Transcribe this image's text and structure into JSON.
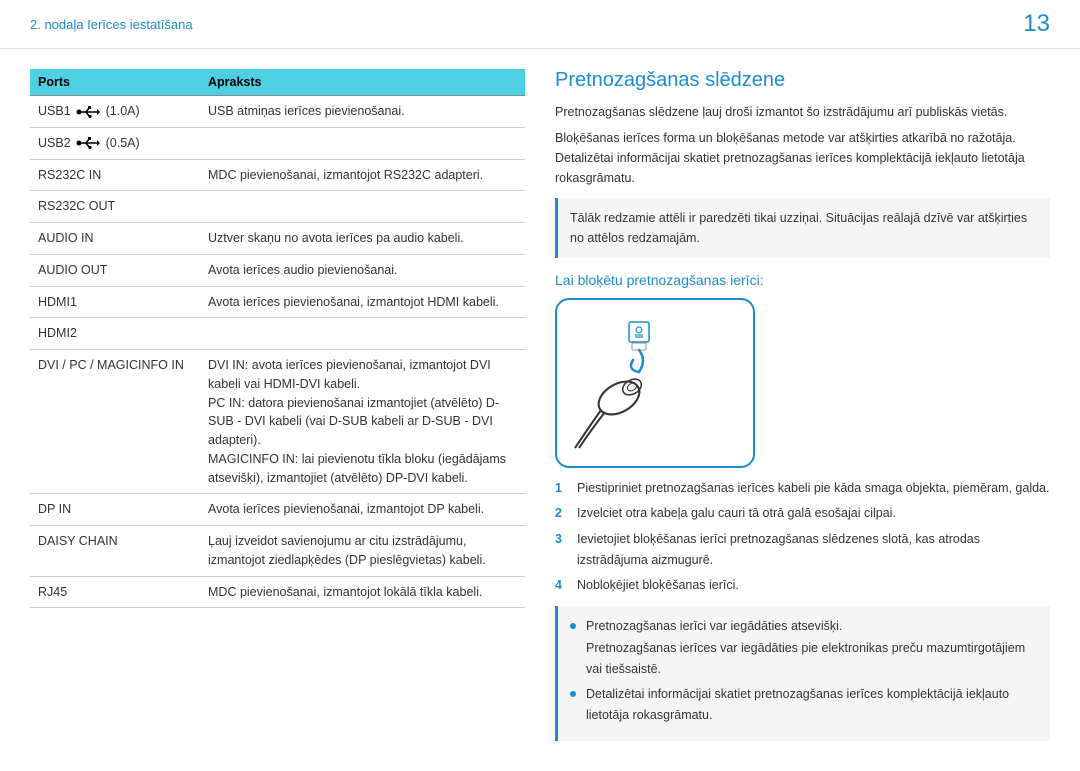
{
  "header": {
    "chapter": "2. nodaļa Ierīces iestatīšana",
    "page": "13"
  },
  "table": {
    "head": {
      "col1": "Ports",
      "col2": "Apraksts"
    },
    "rows": [
      {
        "port": "USB1",
        "icon": "usb",
        "extra": "(1.0A)",
        "desc": "USB atmiņas ierīces pievienošanai."
      },
      {
        "port": "USB2",
        "icon": "usb",
        "extra": "(0.5A)",
        "desc": ""
      },
      {
        "port": "RS232C IN",
        "desc": "MDC pievienošanai, izmantojot RS232C adapteri."
      },
      {
        "port": "RS232C OUT",
        "desc": ""
      },
      {
        "port": "AUDIO IN",
        "desc": "Uztver skaņu no avota ierīces pa audio kabeli."
      },
      {
        "port": "AUDIO OUT",
        "desc": "Avota ierīces audio pievienošanai."
      },
      {
        "port": "HDMI1",
        "desc": "Avota ierīces pievienošanai, izmantojot HDMI kabeli."
      },
      {
        "port": "HDMI2",
        "desc": ""
      },
      {
        "port": "DVI / PC / MAGICINFO IN",
        "desc": "DVI IN: avota ierīces pievienošanai, izmantojot DVI kabeli vai HDMI-DVI kabeli.\nPC IN: datora pievienošanai izmantojiet (atvēlēto) D-SUB - DVI kabeli (vai D-SUB kabeli ar D-SUB - DVI adapteri).\nMAGICINFO IN: lai pievienotu tīkla bloku (iegādājams atsevišķi), izmantojiet (atvēlēto) DP-DVI kabeli."
      },
      {
        "port": "DP IN",
        "desc": "Avota ierīces pievienošanai, izmantojot DP kabeli."
      },
      {
        "port": "DAISY CHAIN",
        "desc": "Ļauj izveidot savienojumu ar citu izstrādājumu, izmantojot ziedlapķēdes (DP pieslēgvietas) kabeli."
      },
      {
        "port": "RJ45",
        "desc": "MDC pievienošanai, izmantojot lokālā tīkla kabeli."
      }
    ]
  },
  "right": {
    "title": "Pretnozagšanas slēdzene",
    "p1": "Pretnozagšanas slēdzene ļauj droši izmantot šo izstrādājumu arī publiskās vietās.",
    "p2": "Bloķēšanas ierīces forma un bloķēšanas metode var atšķirties atkarībā no ražotāja. Detalizētai informācijai skatiet pretnozagšanas ierīces komplektācijā iekļauto lietotāja rokasgrāmatu.",
    "info1": "Tālāk redzamie attēli ir paredzēti tikai uzziņai. Situācijas reālajā dzīvē var atšķirties no attēlos redzamajām.",
    "subtitle": "Lai bloķētu pretnozagšanas ierīci:",
    "steps": [
      "Piestipriniet pretnozagšanas ierīces kabeli pie kāda smaga objekta, piemēram, galda.",
      "Izvelciet otra kabeļa galu cauri tā otrā galā esošajai cilpai.",
      "Ievietojiet bloķēšanas ierīci pretnozagšanas slēdzenes slotā, kas atrodas izstrādājuma aizmugurē.",
      "Nobloķējiet bloķēšanas ierīci."
    ],
    "bullets": [
      "Pretnozagšanas ierīci var iegādāties atsevišķi.\nPretnozagšanas ierīces var iegādāties pie elektronikas preču mazumtirgotājiem vai tiešsaistē.",
      "Detalizētai informācijai skatiet pretnozagšanas ierīces komplektācijā iekļauto lietotāja rokasgrāmatu."
    ]
  }
}
